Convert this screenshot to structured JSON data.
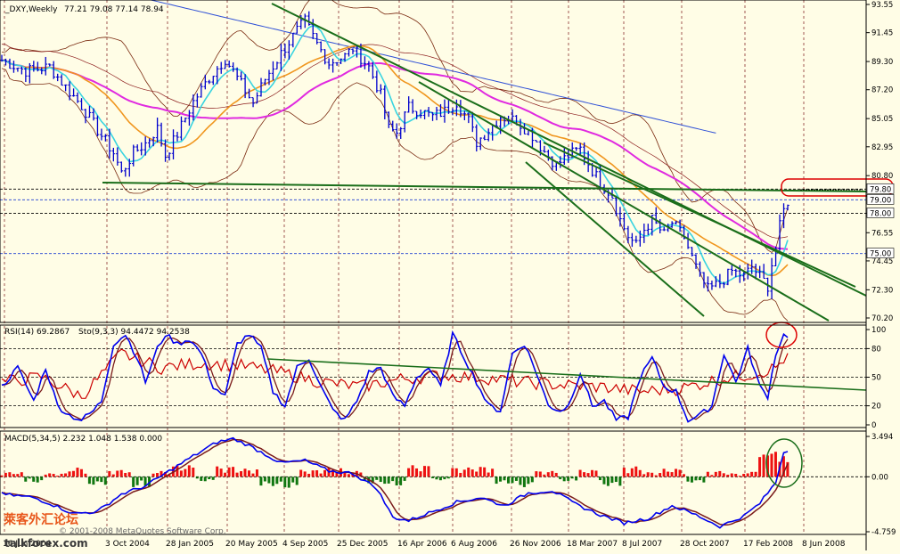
{
  "header": {
    "symbol": "_DXY,Weekly",
    "ohlc": "77.21 79.08 77.14 78.94"
  },
  "rsi_header": "RSI(14) 69.2867",
  "stoch_header": "Sto(9,3,3) 94.4472 94.2538",
  "macd_header": "MACD(5,34,5) 2.232 1.048 1.538 0.000",
  "watermark": {
    "copyright": "© 2001-2008 MetaQuotes Software Corp.",
    "site": "talkforex.com",
    "logo_text": "萊客外汇论坛"
  },
  "colors": {
    "bg": "#fffde6",
    "grid": "#8b2e2e",
    "candle": "#0000cc",
    "ma_fast": "#39d4e0",
    "ma_mid": "#f0961e",
    "ma_slow": "#e02ae0",
    "ma_long": "#2e4fd6",
    "bollinger": "#7a2a10",
    "trend": "#1a6e1a",
    "rsi": "#cc0000",
    "stoch_main": "#0000ee",
    "stoch_signal": "#7a1a1a",
    "hist_pos": "#ee1111",
    "hist_neg": "#117711",
    "highlight": "#dd0000"
  },
  "chart_data": [
    {
      "type": "candlestick",
      "panel": "price",
      "y_ticks": [
        "93.55",
        "91.45",
        "89.30",
        "87.20",
        "85.05",
        "82.95",
        "80.80",
        "78.00",
        "76.55",
        "74.45",
        "72.30",
        "70.20"
      ],
      "ylim": [
        70.2,
        93.55
      ],
      "price_labels": [
        "79.80",
        "79.00",
        "78.00",
        "75.00"
      ],
      "x_ticks": [
        "16 Jun 2004",
        "3 Oct 2004",
        "28 Jan 2005",
        "20 May 2005",
        "4 Sep 2005",
        "25 Dec 2005",
        "16 Apr 2006",
        "6 Aug 2006",
        "26 Nov 2006",
        "18 Mar 2007",
        "8 Jul 2007",
        "28 Oct 2007",
        "17 Feb 2008",
        "8 Jun 2008"
      ],
      "close_path": [
        [
          0,
          89.4
        ],
        [
          6,
          88.6
        ],
        [
          12,
          88.9
        ],
        [
          16,
          87.4
        ],
        [
          20,
          86.0
        ],
        [
          24,
          84.2
        ],
        [
          28,
          82.5
        ],
        [
          30,
          81.0
        ],
        [
          33,
          82.5
        ],
        [
          36,
          83.2
        ],
        [
          39,
          84.3
        ],
        [
          41,
          82.3
        ],
        [
          44,
          83.9
        ],
        [
          48,
          86.3
        ],
        [
          52,
          88.1
        ],
        [
          56,
          89.5
        ],
        [
          60,
          87.6
        ],
        [
          63,
          86.2
        ],
        [
          66,
          88.0
        ],
        [
          70,
          89.9
        ],
        [
          74,
          91.6
        ],
        [
          76,
          92.3
        ],
        [
          79,
          90.6
        ],
        [
          82,
          89.2
        ],
        [
          86,
          89.7
        ],
        [
          88,
          90.3
        ],
        [
          92,
          88.9
        ],
        [
          95,
          86.8
        ],
        [
          97,
          84.3
        ],
        [
          99,
          84.0
        ],
        [
          102,
          85.9
        ],
        [
          105,
          85.6
        ],
        [
          108,
          85.2
        ],
        [
          111,
          85.6
        ],
        [
          114,
          86.3
        ],
        [
          117,
          84.9
        ],
        [
          119,
          83.3
        ],
        [
          122,
          84.2
        ],
        [
          125,
          85.2
        ],
        [
          129,
          84.9
        ],
        [
          133,
          83.8
        ],
        [
          136,
          82.6
        ],
        [
          139,
          81.6
        ],
        [
          142,
          82.3
        ],
        [
          145,
          82.8
        ],
        [
          148,
          81.2
        ],
        [
          150,
          80.3
        ],
        [
          153,
          79.3
        ],
        [
          155,
          77.5
        ],
        [
          157,
          76.3
        ],
        [
          159,
          75.6
        ],
        [
          161,
          76.8
        ],
        [
          163,
          77.5
        ],
        [
          166,
          76.4
        ],
        [
          168,
          77.3
        ],
        [
          171,
          76.2
        ],
        [
          173,
          74.7
        ],
        [
          175,
          73.2
        ],
        [
          177,
          72.3
        ],
        [
          180,
          72.8
        ],
        [
          183,
          73.7
        ],
        [
          186,
          73.3
        ],
        [
          188,
          74.0
        ],
        [
          190,
          73.3
        ],
        [
          192,
          72.6
        ],
        [
          193,
          74.2
        ],
        [
          194,
          75.4
        ],
        [
          195,
          77.0
        ],
        [
          196,
          78.2
        ],
        [
          197,
          78.9
        ]
      ],
      "bars": 198
    },
    {
      "type": "line",
      "panel": "rsi_stoch",
      "y_ticks": [
        "100",
        "80",
        "50",
        "20",
        "0"
      ],
      "ylim": [
        0,
        100
      ],
      "series": [
        {
          "name": "RSI(14)"
        },
        {
          "name": "Sto(9,3,3)"
        }
      ],
      "stoch_path": [
        [
          0,
          40
        ],
        [
          4,
          60
        ],
        [
          8,
          25
        ],
        [
          11,
          60
        ],
        [
          14,
          20
        ],
        [
          17,
          10
        ],
        [
          20,
          5
        ],
        [
          23,
          15
        ],
        [
          25,
          25
        ],
        [
          28,
          85
        ],
        [
          31,
          95
        ],
        [
          34,
          70
        ],
        [
          36,
          45
        ],
        [
          39,
          80
        ],
        [
          41,
          95
        ],
        [
          44,
          85
        ],
        [
          47,
          90
        ],
        [
          50,
          75
        ],
        [
          53,
          40
        ],
        [
          56,
          30
        ],
        [
          59,
          85
        ],
        [
          62,
          95
        ],
        [
          65,
          80
        ],
        [
          68,
          35
        ],
        [
          71,
          20
        ],
        [
          74,
          60
        ],
        [
          77,
          70
        ],
        [
          80,
          40
        ],
        [
          83,
          15
        ],
        [
          86,
          5
        ],
        [
          89,
          25
        ],
        [
          92,
          55
        ],
        [
          95,
          60
        ],
        [
          98,
          30
        ],
        [
          101,
          20
        ],
        [
          104,
          50
        ],
        [
          107,
          60
        ],
        [
          110,
          40
        ],
        [
          113,
          95
        ],
        [
          116,
          70
        ],
        [
          119,
          45
        ],
        [
          122,
          20
        ],
        [
          125,
          15
        ],
        [
          128,
          75
        ],
        [
          131,
          85
        ],
        [
          134,
          55
        ],
        [
          137,
          20
        ],
        [
          140,
          15
        ],
        [
          142,
          20
        ],
        [
          145,
          55
        ],
        [
          148,
          20
        ],
        [
          151,
          25
        ],
        [
          154,
          5
        ],
        [
          157,
          8
        ],
        [
          160,
          50
        ],
        [
          163,
          70
        ],
        [
          166,
          40
        ],
        [
          169,
          35
        ],
        [
          172,
          5
        ],
        [
          175,
          10
        ],
        [
          178,
          20
        ],
        [
          181,
          75
        ],
        [
          184,
          45
        ],
        [
          187,
          80
        ],
        [
          190,
          40
        ],
        [
          192,
          30
        ],
        [
          194,
          75
        ],
        [
          196,
          94
        ]
      ],
      "rsi_path": [
        [
          0,
          45
        ],
        [
          10,
          50
        ],
        [
          20,
          30
        ],
        [
          30,
          75
        ],
        [
          40,
          60
        ],
        [
          50,
          65
        ],
        [
          60,
          62
        ],
        [
          70,
          55
        ],
        [
          80,
          45
        ],
        [
          90,
          40
        ],
        [
          100,
          48
        ],
        [
          110,
          52
        ],
        [
          120,
          50
        ],
        [
          130,
          45
        ],
        [
          140,
          42
        ],
        [
          150,
          40
        ],
        [
          160,
          35
        ],
        [
          170,
          38
        ],
        [
          180,
          48
        ],
        [
          186,
          52
        ],
        [
          190,
          55
        ],
        [
          194,
          60
        ],
        [
          196,
          69
        ]
      ],
      "trendline_label": "",
      "levels": [
        80,
        50,
        20
      ]
    },
    {
      "type": "bar",
      "panel": "macd",
      "y_ticks": [
        "3.494",
        "0.00",
        "-4.759"
      ],
      "ylim": [
        -4.759,
        3.494
      ],
      "macd_path": [
        [
          0,
          -1.5
        ],
        [
          8,
          -1.8
        ],
        [
          12,
          -2.3
        ],
        [
          18,
          -3.2
        ],
        [
          24,
          -3.0
        ],
        [
          30,
          -1.5
        ],
        [
          36,
          -0.8
        ],
        [
          42,
          0.5
        ],
        [
          48,
          1.8
        ],
        [
          54,
          3.0
        ],
        [
          58,
          3.3
        ],
        [
          62,
          2.7
        ],
        [
          70,
          1.2
        ],
        [
          76,
          1.4
        ],
        [
          82,
          0.5
        ],
        [
          88,
          0.3
        ],
        [
          94,
          -1.0
        ],
        [
          98,
          -3.5
        ],
        [
          102,
          -3.8
        ],
        [
          108,
          -3.0
        ],
        [
          114,
          -2.2
        ],
        [
          120,
          -1.8
        ],
        [
          126,
          -2.5
        ],
        [
          132,
          -1.4
        ],
        [
          138,
          -1.2
        ],
        [
          144,
          -2.4
        ],
        [
          150,
          -3.3
        ],
        [
          156,
          -4.0
        ],
        [
          162,
          -3.6
        ],
        [
          168,
          -2.5
        ],
        [
          174,
          -3.3
        ],
        [
          180,
          -4.3
        ],
        [
          186,
          -3.4
        ],
        [
          190,
          -2.3
        ],
        [
          194,
          -0.5
        ],
        [
          196,
          2.2
        ]
      ],
      "hist_samples": [
        0.4,
        -0.5,
        0.3,
        0.8,
        -0.7,
        0.6,
        -0.9,
        0.5,
        1.0,
        -0.4,
        0.9,
        0.7,
        -0.8,
        -1.0,
        0.6,
        0.8,
        0.5,
        -0.6,
        -0.8,
        1.0,
        -0.3,
        0.8,
        0.9,
        -0.6,
        -0.9,
        0.5,
        -0.4,
        0.6,
        -0.8,
        0.9,
        0.4,
        0.7,
        -0.5,
        0.5,
        0.3,
        0.7,
        1.6
      ]
    }
  ]
}
